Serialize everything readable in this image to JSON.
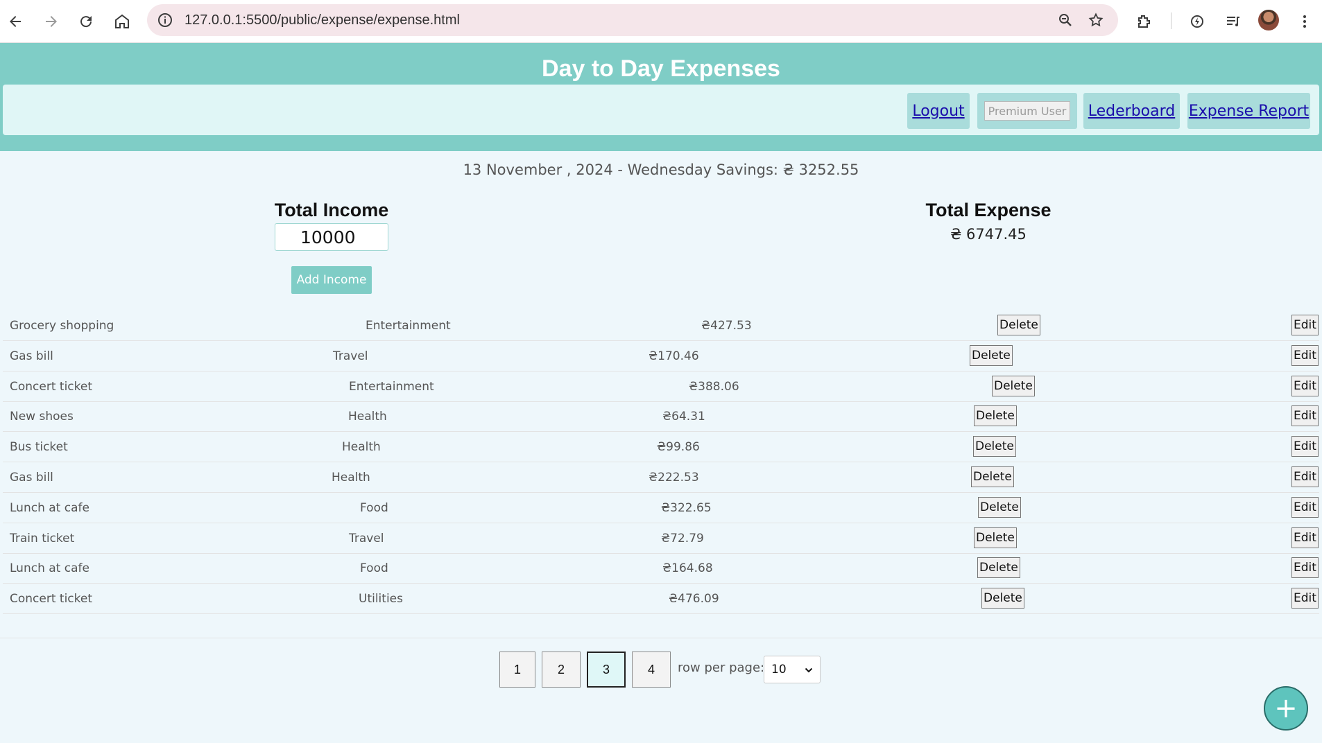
{
  "browser": {
    "url": "127.0.0.1:5500/public/expense/expense.html"
  },
  "app": {
    "title": "Day to Day Expenses",
    "nav": {
      "logout": "Logout",
      "premium": "Premium User",
      "leaderboard": "Lederboard",
      "report": "Expense Report"
    }
  },
  "summary": {
    "date_line": "13 November , 2024 - Wednesday Savings: ₴ 3252.55",
    "income_title": "Total Income",
    "income_value": "10000",
    "add_income": "Add Income",
    "expense_title": "Total Expense",
    "expense_total": "₴ 6747.45"
  },
  "expenses": [
    {
      "description": "Grocery shopping",
      "category": "Entertainment",
      "amount": "₴427.53",
      "delete": "Delete",
      "edit": "Edit"
    },
    {
      "description": "Gas bill",
      "category": "Travel",
      "amount": "₴170.46",
      "delete": "Delete",
      "edit": "Edit"
    },
    {
      "description": "Concert ticket",
      "category": "Entertainment",
      "amount": "₴388.06",
      "delete": "Delete",
      "edit": "Edit"
    },
    {
      "description": "New shoes",
      "category": "Health",
      "amount": "₴64.31",
      "delete": "Delete",
      "edit": "Edit"
    },
    {
      "description": "Bus ticket",
      "category": "Health",
      "amount": "₴99.86",
      "delete": "Delete",
      "edit": "Edit"
    },
    {
      "description": "Gas bill",
      "category": "Health",
      "amount": "₴222.53",
      "delete": "Delete",
      "edit": "Edit"
    },
    {
      "description": "Lunch at cafe",
      "category": "Food",
      "amount": "₴322.65",
      "delete": "Delete",
      "edit": "Edit"
    },
    {
      "description": "Train ticket",
      "category": "Travel",
      "amount": "₴72.79",
      "delete": "Delete",
      "edit": "Edit"
    },
    {
      "description": "Lunch at cafe",
      "category": "Food",
      "amount": "₴164.68",
      "delete": "Delete",
      "edit": "Edit"
    },
    {
      "description": "Concert ticket",
      "category": "Utilities",
      "amount": "₴476.09",
      "delete": "Delete",
      "edit": "Edit"
    }
  ],
  "pagination": {
    "pages": [
      "1",
      "2",
      "3",
      "4"
    ],
    "current": "3",
    "rows_label": "row per page:",
    "rows_value": "10"
  },
  "fab": {
    "label": "+"
  },
  "colors": {
    "header": "#7fcdc6",
    "nav_bar": "#e0f6f6",
    "nav_button": "#a9dcdb",
    "page_bg": "#eef7fb",
    "fab": "#5ec4bd"
  },
  "icons": [
    "back-icon",
    "forward-icon",
    "reload-icon",
    "home-icon",
    "site-info-icon",
    "zoom-icon",
    "bookmark-star-icon",
    "extensions-icon",
    "performance-icon",
    "media-control-icon",
    "avatar",
    "more-menu-icon",
    "chevron-down-icon",
    "plus-icon"
  ]
}
